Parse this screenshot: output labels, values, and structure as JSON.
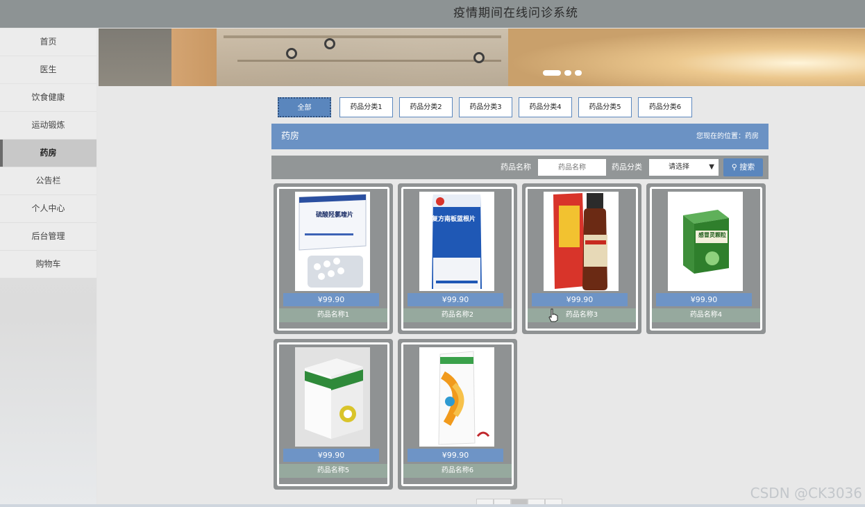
{
  "header": {
    "title": "疫情期间在线问诊系统"
  },
  "sidebar": {
    "items": [
      {
        "label": "首页",
        "active": false
      },
      {
        "label": "医生",
        "active": false
      },
      {
        "label": "饮食健康",
        "active": false
      },
      {
        "label": "运动锻炼",
        "active": false
      },
      {
        "label": "药房",
        "active": true
      },
      {
        "label": "公告栏",
        "active": false
      },
      {
        "label": "个人中心",
        "active": false
      },
      {
        "label": "后台管理",
        "active": false
      },
      {
        "label": "购物车",
        "active": false
      }
    ]
  },
  "tabs": [
    "全部",
    "药品分类1",
    "药品分类2",
    "药品分类3",
    "药品分类4",
    "药品分类5",
    "药品分类6"
  ],
  "section": {
    "title": "药房",
    "location": "您现在的位置：药房"
  },
  "search": {
    "name_label": "药品名称",
    "name_placeholder": "药品名称",
    "category_label": "药品分类",
    "category_value": "请选择",
    "button_label": "搜索"
  },
  "products": [
    {
      "price": "¥99.90",
      "name": "药品名称1"
    },
    {
      "price": "¥99.90",
      "name": "药品名称2"
    },
    {
      "price": "¥99.90",
      "name": "药品名称3"
    },
    {
      "price": "¥99.90",
      "name": "药品名称4"
    },
    {
      "price": "¥99.90",
      "name": "药品名称5"
    },
    {
      "price": "¥99.90",
      "name": "药品名称6"
    }
  ],
  "package_text": {
    "p1_title": "硫酸羟氯喹片",
    "p2_title": "复方南板蓝根片",
    "p4_title": "感冒灵颗粒"
  },
  "colors": {
    "accent": "#5a86bd",
    "header": "#8d9394",
    "card_name": "#96a99e"
  },
  "watermark": "CSDN @CK3036"
}
